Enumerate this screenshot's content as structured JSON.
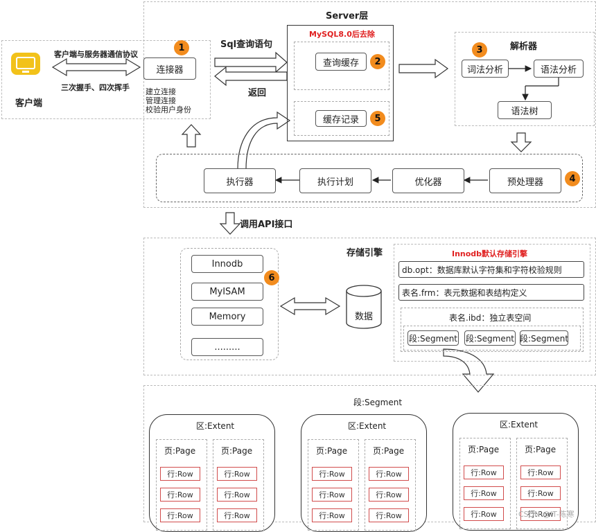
{
  "client": {
    "label": "客户端",
    "protocol": "客户端与服务器通信协议",
    "handshake": "三次握手、四次挥手"
  },
  "server": {
    "title": "Server层",
    "sql_label": "Sql查询语句",
    "return_label": "返回",
    "removed_label": "MySQL8.0后去除",
    "connector": "连接器",
    "connector_notes": [
      "建立连接",
      "管理连接",
      "校验用户身份"
    ],
    "query_cache": "查询缓存",
    "cache_record": "缓存记录",
    "parser_title": "解析器",
    "lexical": "词法分析",
    "syntax": "语法分析",
    "syntax_tree": "语法树",
    "preprocessor": "预处理器",
    "optimizer": "优化器",
    "exec_plan": "执行计划",
    "executor": "执行器"
  },
  "badges": [
    "1",
    "2",
    "3",
    "4",
    "5",
    "6"
  ],
  "api_label": "调用API接口",
  "storage": {
    "title": "存储引擎",
    "engines": [
      "Innodb",
      "MyISAM",
      "Memory",
      "........."
    ],
    "data_label": "数据",
    "innodb_title": "Innodb默认存储引擎",
    "db_opt": "db.opt：数据库默认字符集和字符校验规则",
    "frm": "表名.frm：表元数据和表结构定义",
    "ibd": "表名.ibd：独立表空间",
    "segments": [
      "段:Segment",
      "段:Segment",
      "段:Segment"
    ]
  },
  "segment_block": {
    "title": "段:Segment",
    "extents": [
      {
        "title": "区:Extent",
        "pages": [
          {
            "title": "页:Page",
            "rows": [
              "行:Row",
              "行:Row",
              "行:Row"
            ]
          },
          {
            "title": "页:Page",
            "rows": [
              "行:Row",
              "行:Row",
              "行:Row"
            ]
          }
        ]
      },
      {
        "title": "区:Extent",
        "pages": [
          {
            "title": "页:Page",
            "rows": [
              "行:Row",
              "行:Row",
              "行:Row"
            ]
          },
          {
            "title": "页:Page",
            "rows": [
              "行:Row",
              "行:Row",
              "行:Row"
            ]
          }
        ]
      },
      {
        "title": "区:Extent",
        "pages": [
          {
            "title": "页:Page",
            "rows": [
              "行:Row",
              "行:Row",
              "行:Row"
            ]
          },
          {
            "title": "页:Page",
            "rows": [
              "行:Row",
              "行:Row",
              "行:Row"
            ]
          }
        ]
      }
    ]
  },
  "watermark": "CSDN @IT-陈寒",
  "colors": {
    "badge": "#f28c1e",
    "red_text": "#e02020",
    "monitor": "#f2c21a"
  }
}
